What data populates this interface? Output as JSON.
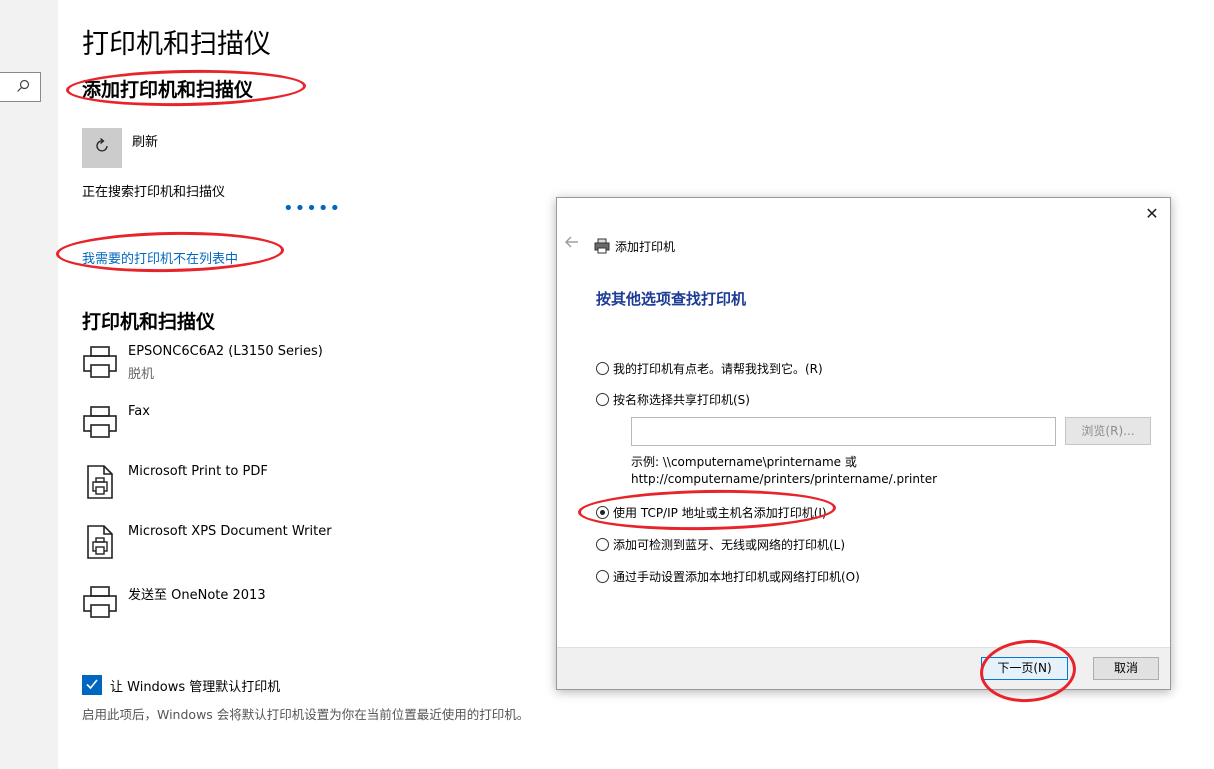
{
  "settings": {
    "page_title": "打印机和扫描仪",
    "add_title": "添加打印机和扫描仪",
    "refresh_label": "刷新",
    "searching_text": "正在搜索打印机和扫描仪",
    "not_listed_link": "我需要的打印机不在列表中",
    "printers_title": "打印机和扫描仪",
    "printers": [
      {
        "name": "EPSONC6C6A2 (L3150 Series)",
        "status": "脱机",
        "icon": "printer-icon"
      },
      {
        "name": "Fax",
        "status": "",
        "icon": "printer-icon"
      },
      {
        "name": "Microsoft Print to PDF",
        "status": "",
        "icon": "document-printer-icon"
      },
      {
        "name": "Microsoft XPS Document Writer",
        "status": "",
        "icon": "document-printer-icon"
      },
      {
        "name": "发送至 OneNote 2013",
        "status": "",
        "icon": "printer-icon"
      }
    ],
    "manage_default_label": "让 Windows 管理默认打印机",
    "manage_default_checked": true,
    "manage_default_desc": "启用此项后，Windows 会将默认打印机设置为你在当前位置最近使用的打印机。"
  },
  "dialog": {
    "title": "添加打印机",
    "heading": "按其他选项查找打印机",
    "options": [
      {
        "label": "我的打印机有点老。请帮我找到它。(R)",
        "selected": false
      },
      {
        "label": "按名称选择共享打印机(S)",
        "selected": false
      },
      {
        "label": "使用 TCP/IP 地址或主机名添加打印机(I)",
        "selected": true
      },
      {
        "label": "添加可检测到蓝牙、无线或网络的打印机(L)",
        "selected": false
      },
      {
        "label": "通过手动设置添加本地打印机或网络打印机(O)",
        "selected": false
      }
    ],
    "share_input_value": "",
    "browse_label": "浏览(R)...",
    "example_line1": "示例: \\\\computername\\printername 或",
    "example_line2": "http://computername/printers/printername/.printer",
    "next_label": "下一页(N)",
    "cancel_label": "取消"
  },
  "colors": {
    "accent": "#0067c0",
    "annotation": "#e8232a",
    "dialog_heading": "#1e3c96"
  }
}
